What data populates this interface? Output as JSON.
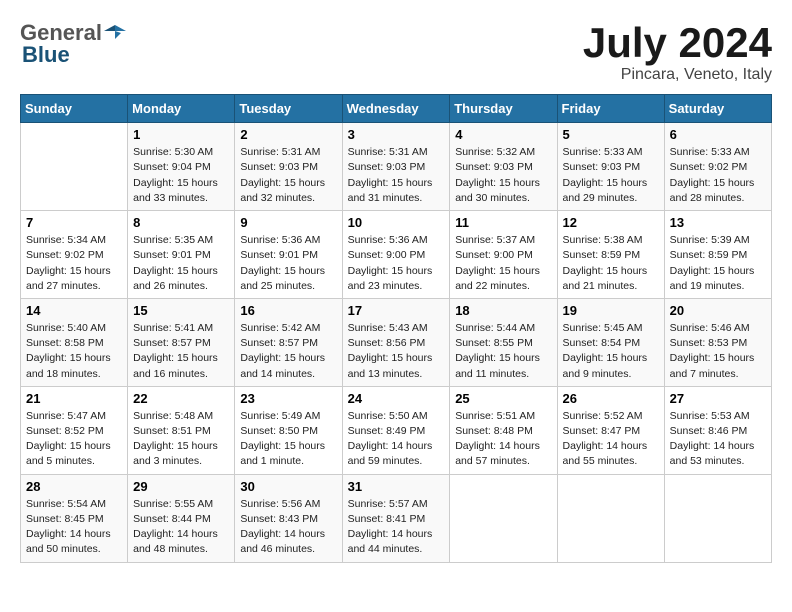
{
  "header": {
    "logo_general": "General",
    "logo_blue": "Blue",
    "title": "July 2024",
    "location": "Pincara, Veneto, Italy"
  },
  "weekdays": [
    "Sunday",
    "Monday",
    "Tuesday",
    "Wednesday",
    "Thursday",
    "Friday",
    "Saturday"
  ],
  "weeks": [
    [
      {
        "date": "",
        "info": ""
      },
      {
        "date": "1",
        "info": "Sunrise: 5:30 AM\nSunset: 9:04 PM\nDaylight: 15 hours\nand 33 minutes."
      },
      {
        "date": "2",
        "info": "Sunrise: 5:31 AM\nSunset: 9:03 PM\nDaylight: 15 hours\nand 32 minutes."
      },
      {
        "date": "3",
        "info": "Sunrise: 5:31 AM\nSunset: 9:03 PM\nDaylight: 15 hours\nand 31 minutes."
      },
      {
        "date": "4",
        "info": "Sunrise: 5:32 AM\nSunset: 9:03 PM\nDaylight: 15 hours\nand 30 minutes."
      },
      {
        "date": "5",
        "info": "Sunrise: 5:33 AM\nSunset: 9:03 PM\nDaylight: 15 hours\nand 29 minutes."
      },
      {
        "date": "6",
        "info": "Sunrise: 5:33 AM\nSunset: 9:02 PM\nDaylight: 15 hours\nand 28 minutes."
      }
    ],
    [
      {
        "date": "7",
        "info": "Sunrise: 5:34 AM\nSunset: 9:02 PM\nDaylight: 15 hours\nand 27 minutes."
      },
      {
        "date": "8",
        "info": "Sunrise: 5:35 AM\nSunset: 9:01 PM\nDaylight: 15 hours\nand 26 minutes."
      },
      {
        "date": "9",
        "info": "Sunrise: 5:36 AM\nSunset: 9:01 PM\nDaylight: 15 hours\nand 25 minutes."
      },
      {
        "date": "10",
        "info": "Sunrise: 5:36 AM\nSunset: 9:00 PM\nDaylight: 15 hours\nand 23 minutes."
      },
      {
        "date": "11",
        "info": "Sunrise: 5:37 AM\nSunset: 9:00 PM\nDaylight: 15 hours\nand 22 minutes."
      },
      {
        "date": "12",
        "info": "Sunrise: 5:38 AM\nSunset: 8:59 PM\nDaylight: 15 hours\nand 21 minutes."
      },
      {
        "date": "13",
        "info": "Sunrise: 5:39 AM\nSunset: 8:59 PM\nDaylight: 15 hours\nand 19 minutes."
      }
    ],
    [
      {
        "date": "14",
        "info": "Sunrise: 5:40 AM\nSunset: 8:58 PM\nDaylight: 15 hours\nand 18 minutes."
      },
      {
        "date": "15",
        "info": "Sunrise: 5:41 AM\nSunset: 8:57 PM\nDaylight: 15 hours\nand 16 minutes."
      },
      {
        "date": "16",
        "info": "Sunrise: 5:42 AM\nSunset: 8:57 PM\nDaylight: 15 hours\nand 14 minutes."
      },
      {
        "date": "17",
        "info": "Sunrise: 5:43 AM\nSunset: 8:56 PM\nDaylight: 15 hours\nand 13 minutes."
      },
      {
        "date": "18",
        "info": "Sunrise: 5:44 AM\nSunset: 8:55 PM\nDaylight: 15 hours\nand 11 minutes."
      },
      {
        "date": "19",
        "info": "Sunrise: 5:45 AM\nSunset: 8:54 PM\nDaylight: 15 hours\nand 9 minutes."
      },
      {
        "date": "20",
        "info": "Sunrise: 5:46 AM\nSunset: 8:53 PM\nDaylight: 15 hours\nand 7 minutes."
      }
    ],
    [
      {
        "date": "21",
        "info": "Sunrise: 5:47 AM\nSunset: 8:52 PM\nDaylight: 15 hours\nand 5 minutes."
      },
      {
        "date": "22",
        "info": "Sunrise: 5:48 AM\nSunset: 8:51 PM\nDaylight: 15 hours\nand 3 minutes."
      },
      {
        "date": "23",
        "info": "Sunrise: 5:49 AM\nSunset: 8:50 PM\nDaylight: 15 hours\nand 1 minute."
      },
      {
        "date": "24",
        "info": "Sunrise: 5:50 AM\nSunset: 8:49 PM\nDaylight: 14 hours\nand 59 minutes."
      },
      {
        "date": "25",
        "info": "Sunrise: 5:51 AM\nSunset: 8:48 PM\nDaylight: 14 hours\nand 57 minutes."
      },
      {
        "date": "26",
        "info": "Sunrise: 5:52 AM\nSunset: 8:47 PM\nDaylight: 14 hours\nand 55 minutes."
      },
      {
        "date": "27",
        "info": "Sunrise: 5:53 AM\nSunset: 8:46 PM\nDaylight: 14 hours\nand 53 minutes."
      }
    ],
    [
      {
        "date": "28",
        "info": "Sunrise: 5:54 AM\nSunset: 8:45 PM\nDaylight: 14 hours\nand 50 minutes."
      },
      {
        "date": "29",
        "info": "Sunrise: 5:55 AM\nSunset: 8:44 PM\nDaylight: 14 hours\nand 48 minutes."
      },
      {
        "date": "30",
        "info": "Sunrise: 5:56 AM\nSunset: 8:43 PM\nDaylight: 14 hours\nand 46 minutes."
      },
      {
        "date": "31",
        "info": "Sunrise: 5:57 AM\nSunset: 8:41 PM\nDaylight: 14 hours\nand 44 minutes."
      },
      {
        "date": "",
        "info": ""
      },
      {
        "date": "",
        "info": ""
      },
      {
        "date": "",
        "info": ""
      }
    ]
  ]
}
